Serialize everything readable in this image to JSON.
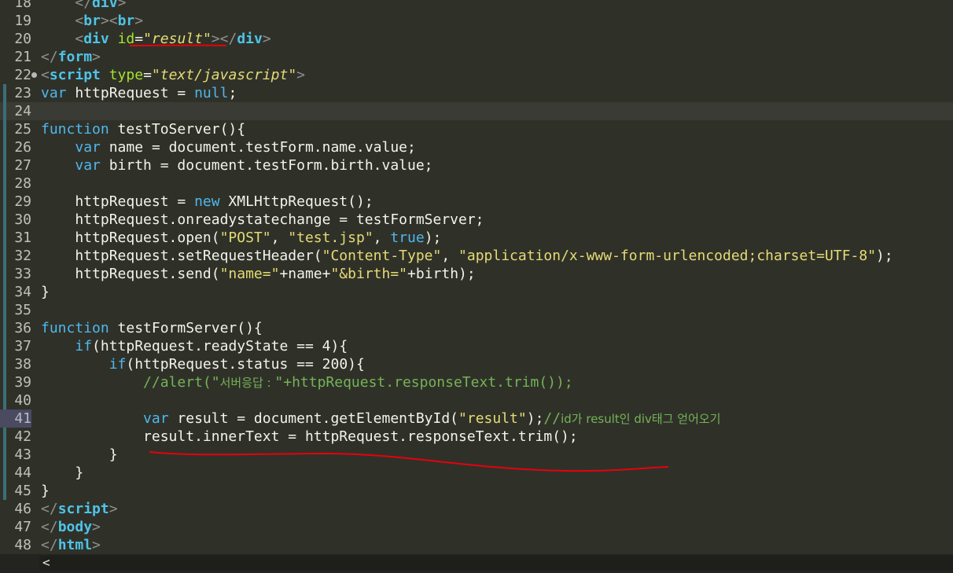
{
  "editor": {
    "lines": [
      {
        "n": "18",
        "html": "    <span class='tag'>&lt;/</span><span class='tn'>div</span><span class='tag'>&gt;</span>"
      },
      {
        "n": "19",
        "html": "    <span class='tag'>&lt;</span><span class='tn'>br</span><span class='tag'>&gt;&lt;</span><span class='tn'>br</span><span class='tag'>&gt;</span>"
      },
      {
        "n": "20",
        "html": "    <span class='tag'>&lt;</span><span class='tn'>div</span> <span class='attr'>id</span><span class='pl'>=</span><span class='str'>\"result\"</span><span class='tag'>&gt;&lt;/</span><span class='tn'>div</span><span class='tag'>&gt;</span>"
      },
      {
        "n": "21",
        "html": "<span class='tag'>&lt;/</span><span class='tn'>form</span><span class='tag'>&gt;</span>"
      },
      {
        "n": "22",
        "fold": true,
        "html": "<span class='tag'>&lt;</span><span class='tn'>script</span> <span class='attr'>type</span><span class='pl'>=</span><span class='str'>\"text/javascript\"</span><span class='tag'>&gt;</span>"
      },
      {
        "n": "23",
        "mark": true,
        "html": "<span class='kw'>var</span> httpRequest = <span class='kw'>null</span>;"
      },
      {
        "n": "24",
        "mark": true,
        "current": true,
        "html": ""
      },
      {
        "n": "25",
        "mark": true,
        "html": "<span class='kw'>function</span> testToServer(){"
      },
      {
        "n": "26",
        "mark": true,
        "html": "    <span class='kw'>var</span> name = document.testForm.name.value;"
      },
      {
        "n": "27",
        "mark": true,
        "html": "    <span class='kw'>var</span> birth = document.testForm.birth.value;"
      },
      {
        "n": "28",
        "mark": true,
        "html": ""
      },
      {
        "n": "29",
        "mark": true,
        "html": "    httpRequest = <span class='kw'>new</span> XMLHttpRequest();"
      },
      {
        "n": "30",
        "mark": true,
        "html": "    httpRequest.onreadystatechange = testFormServer;"
      },
      {
        "n": "31",
        "mark": true,
        "html": "    httpRequest.open(<span class='s'>\"POST\"</span>, <span class='s'>\"test.jsp\"</span>, <span class='kw'>true</span>);"
      },
      {
        "n": "32",
        "mark": true,
        "html": "    httpRequest.setRequestHeader(<span class='s'>\"Content-Type\"</span>, <span class='s'>\"application/x-www-form-urlencoded;charset=UTF-8\"</span>);"
      },
      {
        "n": "33",
        "mark": true,
        "html": "    httpRequest.send(<span class='s'>\"name=\"</span>+name+<span class='s'>\"&amp;birth=\"</span>+birth);"
      },
      {
        "n": "34",
        "mark": true,
        "html": "}"
      },
      {
        "n": "35",
        "mark": true,
        "html": ""
      },
      {
        "n": "36",
        "mark": true,
        "html": "<span class='kw'>function</span> testFormServer(){"
      },
      {
        "n": "37",
        "mark": true,
        "html": "    <span class='kw'>if</span>(httpRequest.readyState == 4){"
      },
      {
        "n": "38",
        "mark": true,
        "html": "        <span class='kw'>if</span>(httpRequest.status == 200){"
      },
      {
        "n": "39",
        "mark": true,
        "html": "            <span class='cm'>//alert(\"</span><span class='cmk'>서버응답 : </span><span class='cm'>\"+httpRequest.responseText.trim());</span>"
      },
      {
        "n": "40",
        "mark": true,
        "html": ""
      },
      {
        "n": "41",
        "mark": true,
        "hl": true,
        "html": "            <span class='kw'>var</span> result = document.getElementById(<span class='s'>\"result\"</span>);<span class='cm'>//</span><span class='cmk'>id가 result인 div태그 얻어오기</span>"
      },
      {
        "n": "42",
        "mark": true,
        "html": "            result.innerText = httpRequest.responseText.trim();"
      },
      {
        "n": "43",
        "mark": true,
        "html": "        }"
      },
      {
        "n": "44",
        "mark": true,
        "html": "    }"
      },
      {
        "n": "45",
        "mark": true,
        "html": "}"
      },
      {
        "n": "46",
        "html": "<span class='tag'>&lt;/</span><span class='tn'>script</span><span class='tag'>&gt;</span>"
      },
      {
        "n": "47",
        "html": "<span class='tag'>&lt;/</span><span class='tn'>body</span><span class='tag'>&gt;</span>"
      },
      {
        "n": "48",
        "html": "<span class='tag'>&lt;/</span><span class='tn'>html</span><span class='tag'>&gt;</span>"
      }
    ],
    "scroll_arrow": "<",
    "annotation_color": "#e8000b"
  }
}
